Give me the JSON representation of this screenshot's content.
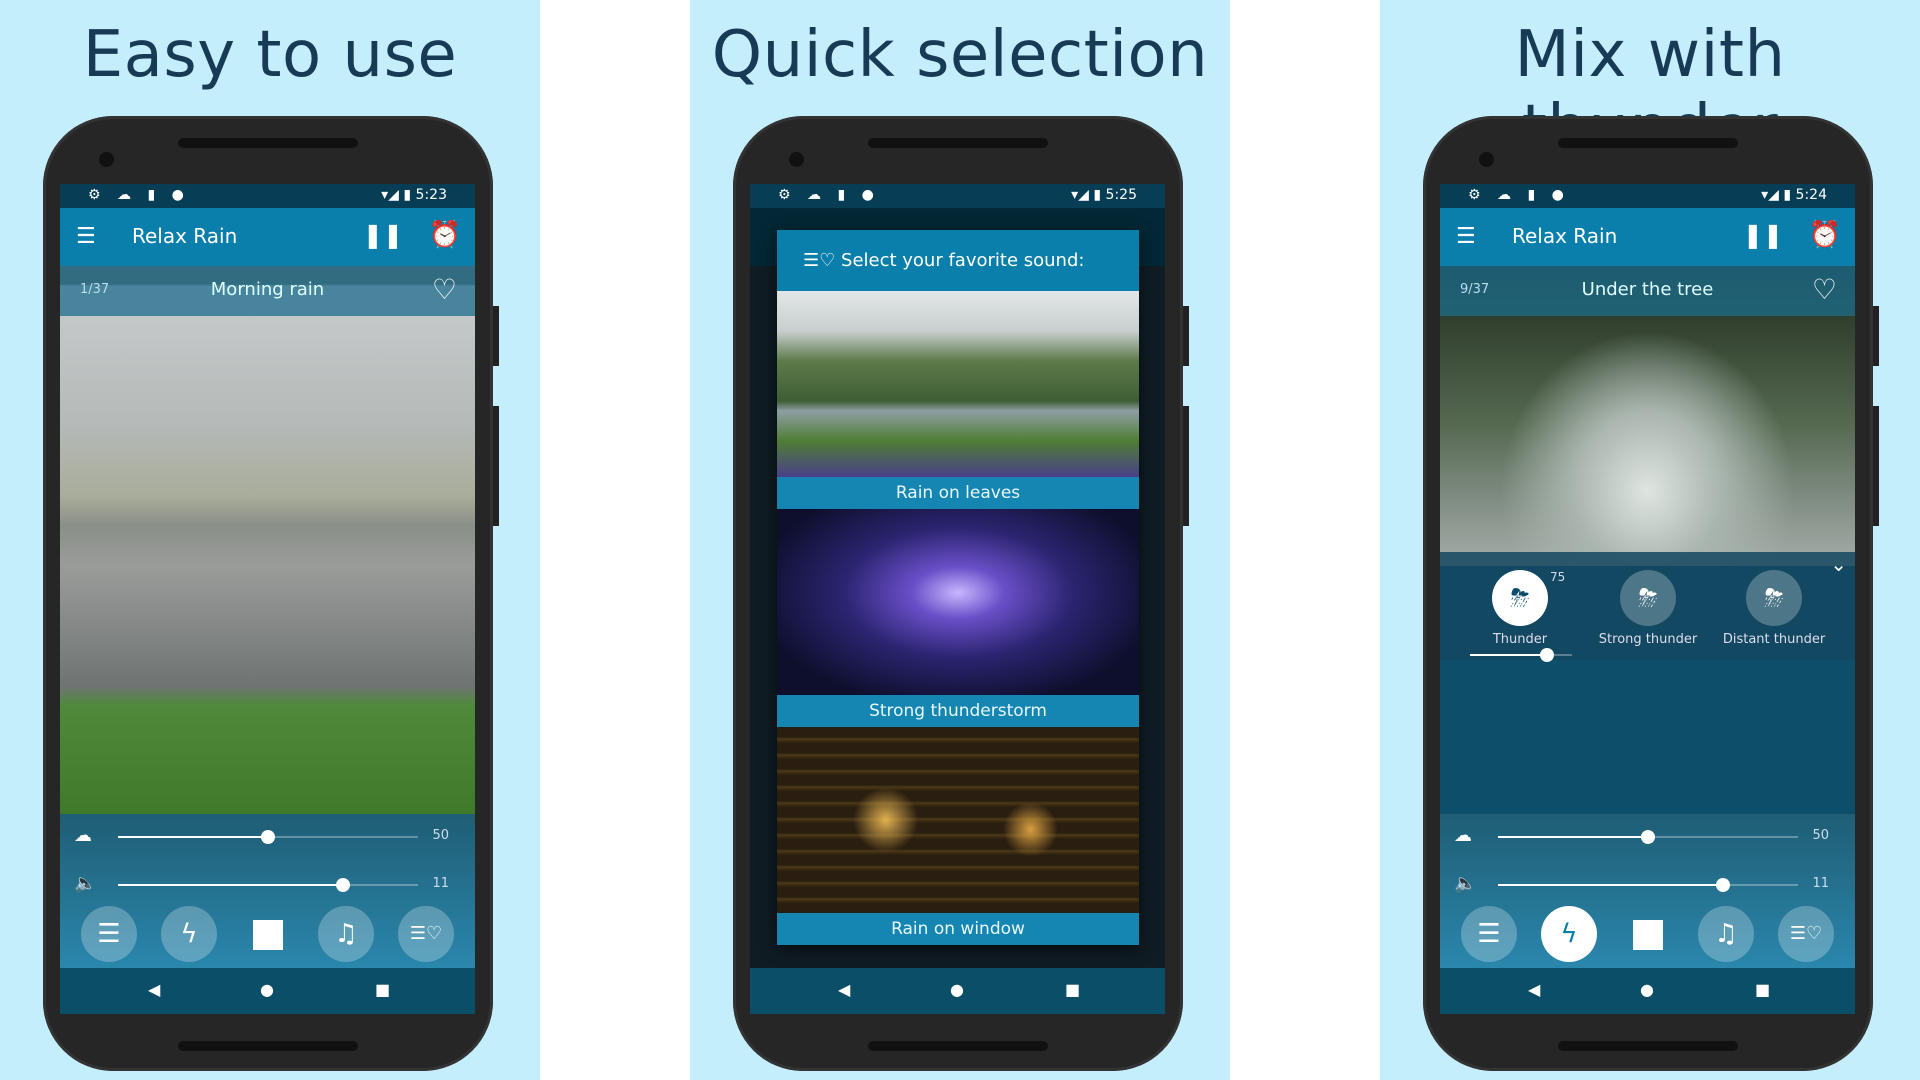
{
  "colors": {
    "panel_bg": "#c4eefc",
    "headline": "#173a55",
    "appbar": "#0a7fab",
    "status_bar": "#073e55"
  },
  "panels": [
    {
      "headline": "Easy to use",
      "status": {
        "icons": "⚙ ☁ ▮ ●",
        "right": "▾◢ ▮ 5:23"
      },
      "app": {
        "menu_icon": "☰",
        "title": "Relax Rain",
        "pause_icon": "❚❚",
        "alarm_icon": "⏰"
      },
      "sound": {
        "count": "1/37",
        "name": "Morning rain",
        "heart_icon": "♡"
      },
      "rain_value": "50",
      "volume_value": "11",
      "rain_level": 50,
      "volume_level": 75
    },
    {
      "headline": "Quick selection",
      "status": {
        "icons": "⚙ ☁ ▮ ●",
        "right": "▾◢ ▮ 5:25"
      },
      "dialog": {
        "title": "Select your favorite sound:",
        "icon": "☰♡",
        "items": [
          "Rain on leaves",
          "Strong thunderstorm",
          "Rain on window"
        ]
      }
    },
    {
      "headline": "Mix with thunder",
      "status": {
        "icons": "⚙ ☁ ▮ ●",
        "right": "▾◢ ▮ 5:24"
      },
      "app": {
        "menu_icon": "☰",
        "title": "Relax Rain",
        "pause_icon": "❚❚",
        "alarm_icon": "⏰"
      },
      "sound": {
        "count": "9/37",
        "name": "Under the tree",
        "heart_icon": "♡"
      },
      "thunder": {
        "items": [
          "Thunder",
          "Strong thunder",
          "Distant thunder"
        ],
        "selected": "Thunder",
        "value": "75",
        "level": 75,
        "collapse_icon": "⌄"
      },
      "rain_value": "50",
      "volume_value": "11",
      "rain_level": 50,
      "volume_level": 75
    }
  ],
  "controls": {
    "rain_icon": "☁",
    "volume_icon": "🔈",
    "buttons": [
      "☰",
      "ϟ",
      "■",
      "♫",
      "☰♡"
    ]
  },
  "nav": {
    "back": "◀",
    "home": "●",
    "recent": "■"
  }
}
